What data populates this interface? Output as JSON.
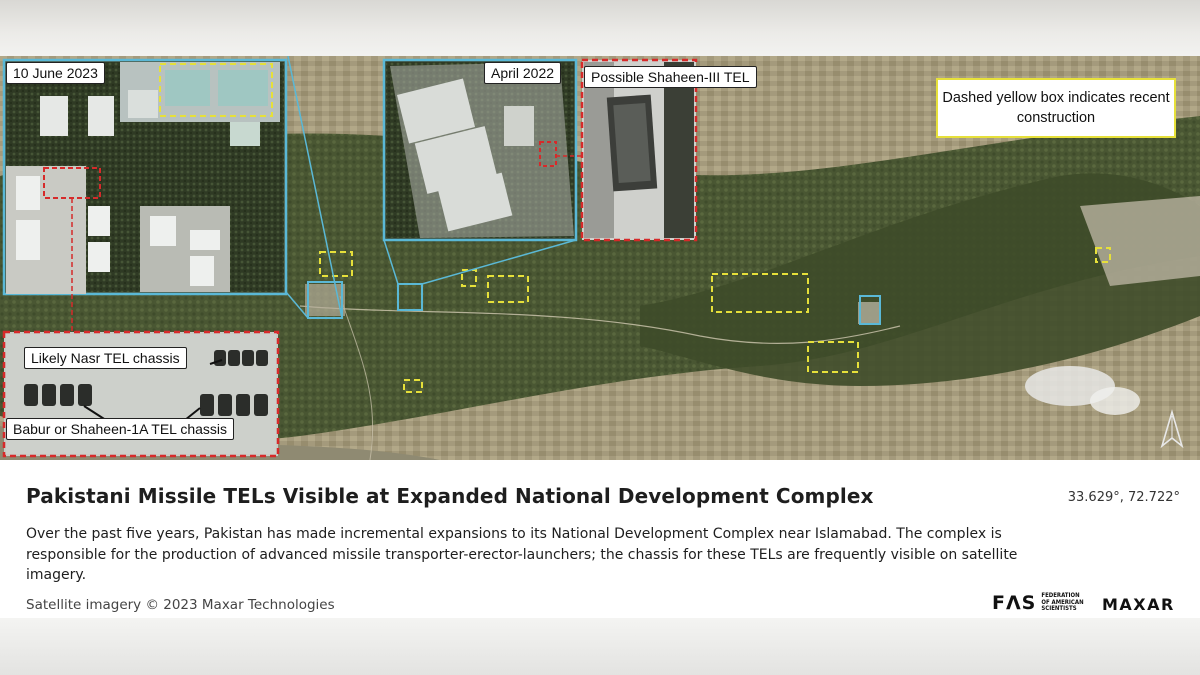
{
  "inset_labels": {
    "date_june": "10 June 2023",
    "date_april": "April 2022",
    "shaheen_iii": "Possible Shaheen-III TEL",
    "nasr": "Likely Nasr TEL chassis",
    "babur": "Babur or Shaheen-1A TEL chassis"
  },
  "legend_note": "Dashed yellow box indicates recent construction",
  "caption": {
    "title": "Pakistani Missile TELs Visible at Expanded National Development Complex",
    "coordinates": "33.629°, 72.722°",
    "body": "Over the past five years, Pakistan has made incremental expansions to its National Development Complex near Islamabad. The complex is responsible for the production of advanced missile transporter-erector-launchers; the chassis for these TELs are frequently visible on satellite imagery.",
    "credit": "Satellite imagery © 2023 Maxar Technologies"
  },
  "logos": {
    "fas_mark": "FΛS",
    "fas_text": "Federation of American Scientists",
    "maxar": "MAXAR"
  },
  "colors": {
    "inset_border_blue": "#5ab8d6",
    "inset_border_red": "#d62a2a",
    "construction_dashed_yellow": "#e6e03a",
    "terrain_green": "#4f5e38",
    "terrain_tan": "#a49a7c"
  },
  "icons": [
    "north-arrow-icon"
  ]
}
